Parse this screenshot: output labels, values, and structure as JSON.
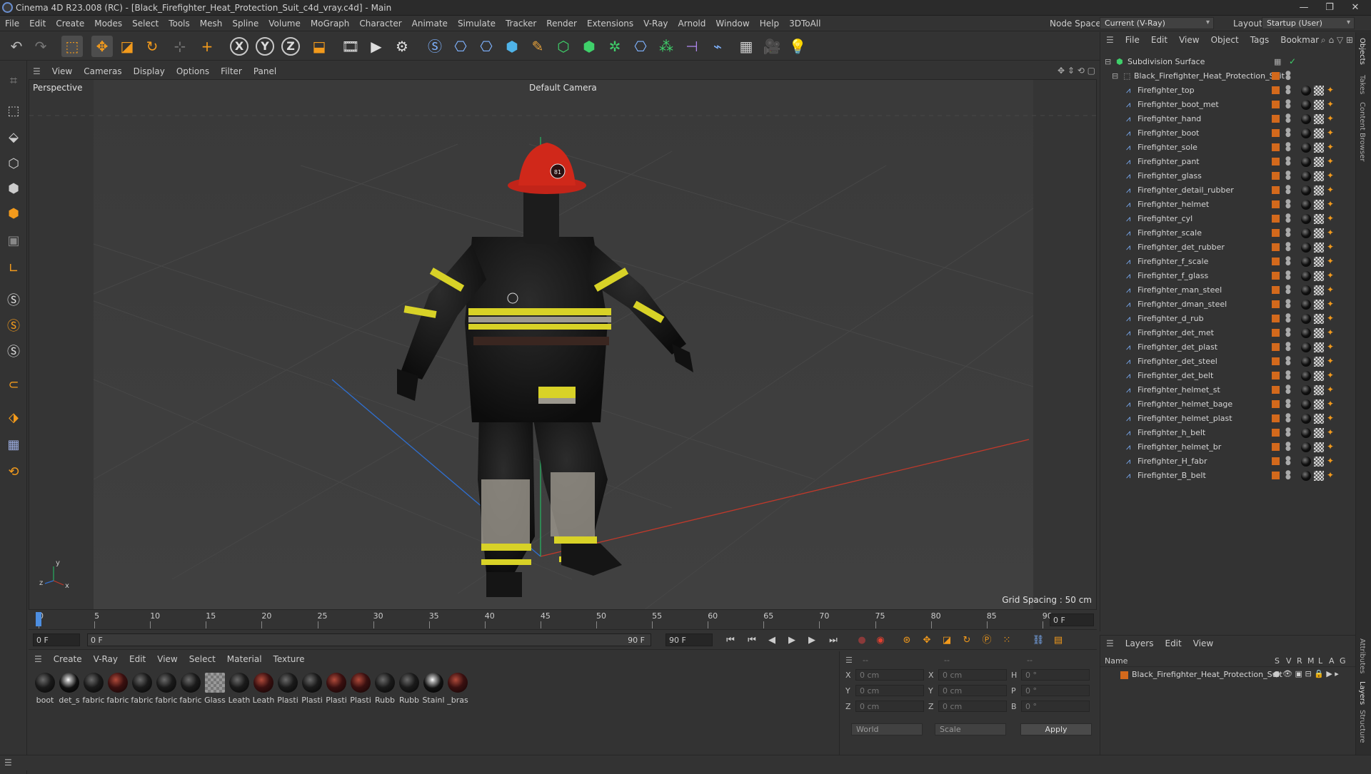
{
  "window": {
    "title": "Cinema 4D R23.008 (RC) - [Black_Firefighter_Heat_Protection_Suit_c4d_vray.c4d] - Main",
    "minimize": "—",
    "restore": "❐",
    "close": "✕"
  },
  "menu": [
    "File",
    "Edit",
    "Create",
    "Modes",
    "Select",
    "Tools",
    "Mesh",
    "Spline",
    "Volume",
    "MoGraph",
    "Character",
    "Animate",
    "Simulate",
    "Tracker",
    "Render",
    "Extensions",
    "V-Ray",
    "Arnold",
    "Window",
    "Help",
    "3DToAll"
  ],
  "node_space": {
    "label": "Node Space:",
    "value": "Current (V-Ray)"
  },
  "layout": {
    "label": "Layout:",
    "value": "Startup (User)"
  },
  "viewport_menu": [
    "View",
    "Cameras",
    "Display",
    "Options",
    "Filter",
    "Panel"
  ],
  "viewport": {
    "name": "Perspective",
    "camera": "Default Camera",
    "grid_spacing": "Grid Spacing : 50 cm",
    "axis_y": "y",
    "axis_z": "z",
    "axis_x": "x",
    "helmet_badge": "81"
  },
  "timeline": {
    "ticks": [
      "0",
      "5",
      "10",
      "15",
      "20",
      "25",
      "30",
      "35",
      "40",
      "45",
      "50",
      "55",
      "60",
      "65",
      "70",
      "75",
      "80",
      "85",
      "90"
    ],
    "frame_end_field": "0 F"
  },
  "playbar": {
    "current": "0 F",
    "range_start": "0 F",
    "range_end": "90 F",
    "max": "90 F"
  },
  "material_menu": [
    "Create",
    "V-Ray",
    "Edit",
    "View",
    "Select",
    "Material",
    "Texture"
  ],
  "materials": [
    {
      "label": "boot",
      "kind": "dark"
    },
    {
      "label": "det_s",
      "kind": "shiny"
    },
    {
      "label": "fabric",
      "kind": "dark"
    },
    {
      "label": "fabric",
      "kind": "red"
    },
    {
      "label": "fabric",
      "kind": "dark"
    },
    {
      "label": "fabric",
      "kind": "dark"
    },
    {
      "label": "fabric",
      "kind": "dark"
    },
    {
      "label": "Glass",
      "kind": "glass"
    },
    {
      "label": "Leath",
      "kind": "dark"
    },
    {
      "label": "Leath",
      "kind": "red"
    },
    {
      "label": "Plasti",
      "kind": "dark"
    },
    {
      "label": "Plasti",
      "kind": "dark"
    },
    {
      "label": "Plasti",
      "kind": "red"
    },
    {
      "label": "Plasti",
      "kind": "red"
    },
    {
      "label": "Rubb",
      "kind": "dark"
    },
    {
      "label": "Rubb",
      "kind": "dark"
    },
    {
      "label": "Stainl",
      "kind": "shiny"
    },
    {
      "label": "_bras",
      "kind": "red"
    }
  ],
  "coords": {
    "header_a": "--",
    "header_b": "--",
    "header_c": "--",
    "rows": [
      {
        "a_label": "X",
        "a_val": "0 cm",
        "b_label": "X",
        "b_val": "0 cm",
        "c_label": "H",
        "c_val": "0 °"
      },
      {
        "a_label": "Y",
        "a_val": "0 cm",
        "b_label": "Y",
        "b_val": "0 cm",
        "c_label": "P",
        "c_val": "0 °"
      },
      {
        "a_label": "Z",
        "a_val": "0 cm",
        "b_label": "Z",
        "b_val": "0 cm",
        "c_label": "B",
        "c_val": "0 °"
      }
    ],
    "space": "World",
    "mode": "Scale",
    "apply": "Apply"
  },
  "objects_menu": [
    "File",
    "Edit",
    "View",
    "Object",
    "Tags",
    "Bookmar"
  ],
  "objects": {
    "root": "Subdivision Surface",
    "group": "Black_Firefighter_Heat_Protection_Suit",
    "children": [
      "Firefighter_top",
      "Firefighter_boot_met",
      "Firefighter_hand",
      "Firefighter_boot",
      "Firefighter_sole",
      "Firefighter_pant",
      "Firefighter_glass",
      "Firefighter_detail_rubber",
      "Firefighter_helmet",
      "Firefighter_cyl",
      "Firefighter_scale",
      "Firefighter_det_rubber",
      "Firefighter_f_scale",
      "Firefighter_f_glass",
      "Firefighter_man_steel",
      "Firefighter_dman_steel",
      "Firefighter_d_rub",
      "Firefighter_det_met",
      "Firefighter_det_plast",
      "Firefighter_det_steel",
      "Firefighter_det_belt",
      "Firefighter_helmet_st",
      "Firefighter_helmet_bage",
      "Firefighter_helmet_plast",
      "Firefighter_h_belt",
      "Firefighter_helmet_br",
      "Firefighter_H_fabr",
      "Firefighter_B_belt"
    ]
  },
  "side_tabs_top": [
    "Objects",
    "Takes",
    "Content Browser"
  ],
  "side_tabs_bottom": [
    "Attributes",
    "Layers",
    "Structure"
  ],
  "layers_menu": [
    "Layers",
    "Edit",
    "View"
  ],
  "layers": {
    "columns": [
      "Name",
      "S",
      "V",
      "R",
      "M",
      "L",
      "A",
      "G"
    ],
    "row": "Black_Firefighter_Heat_Protection_Suit"
  },
  "colors": {
    "accent_orange": "#d3691c",
    "axis_x": "#c0392b",
    "axis_y": "#27ae60",
    "axis_z": "#2f6fd0"
  }
}
